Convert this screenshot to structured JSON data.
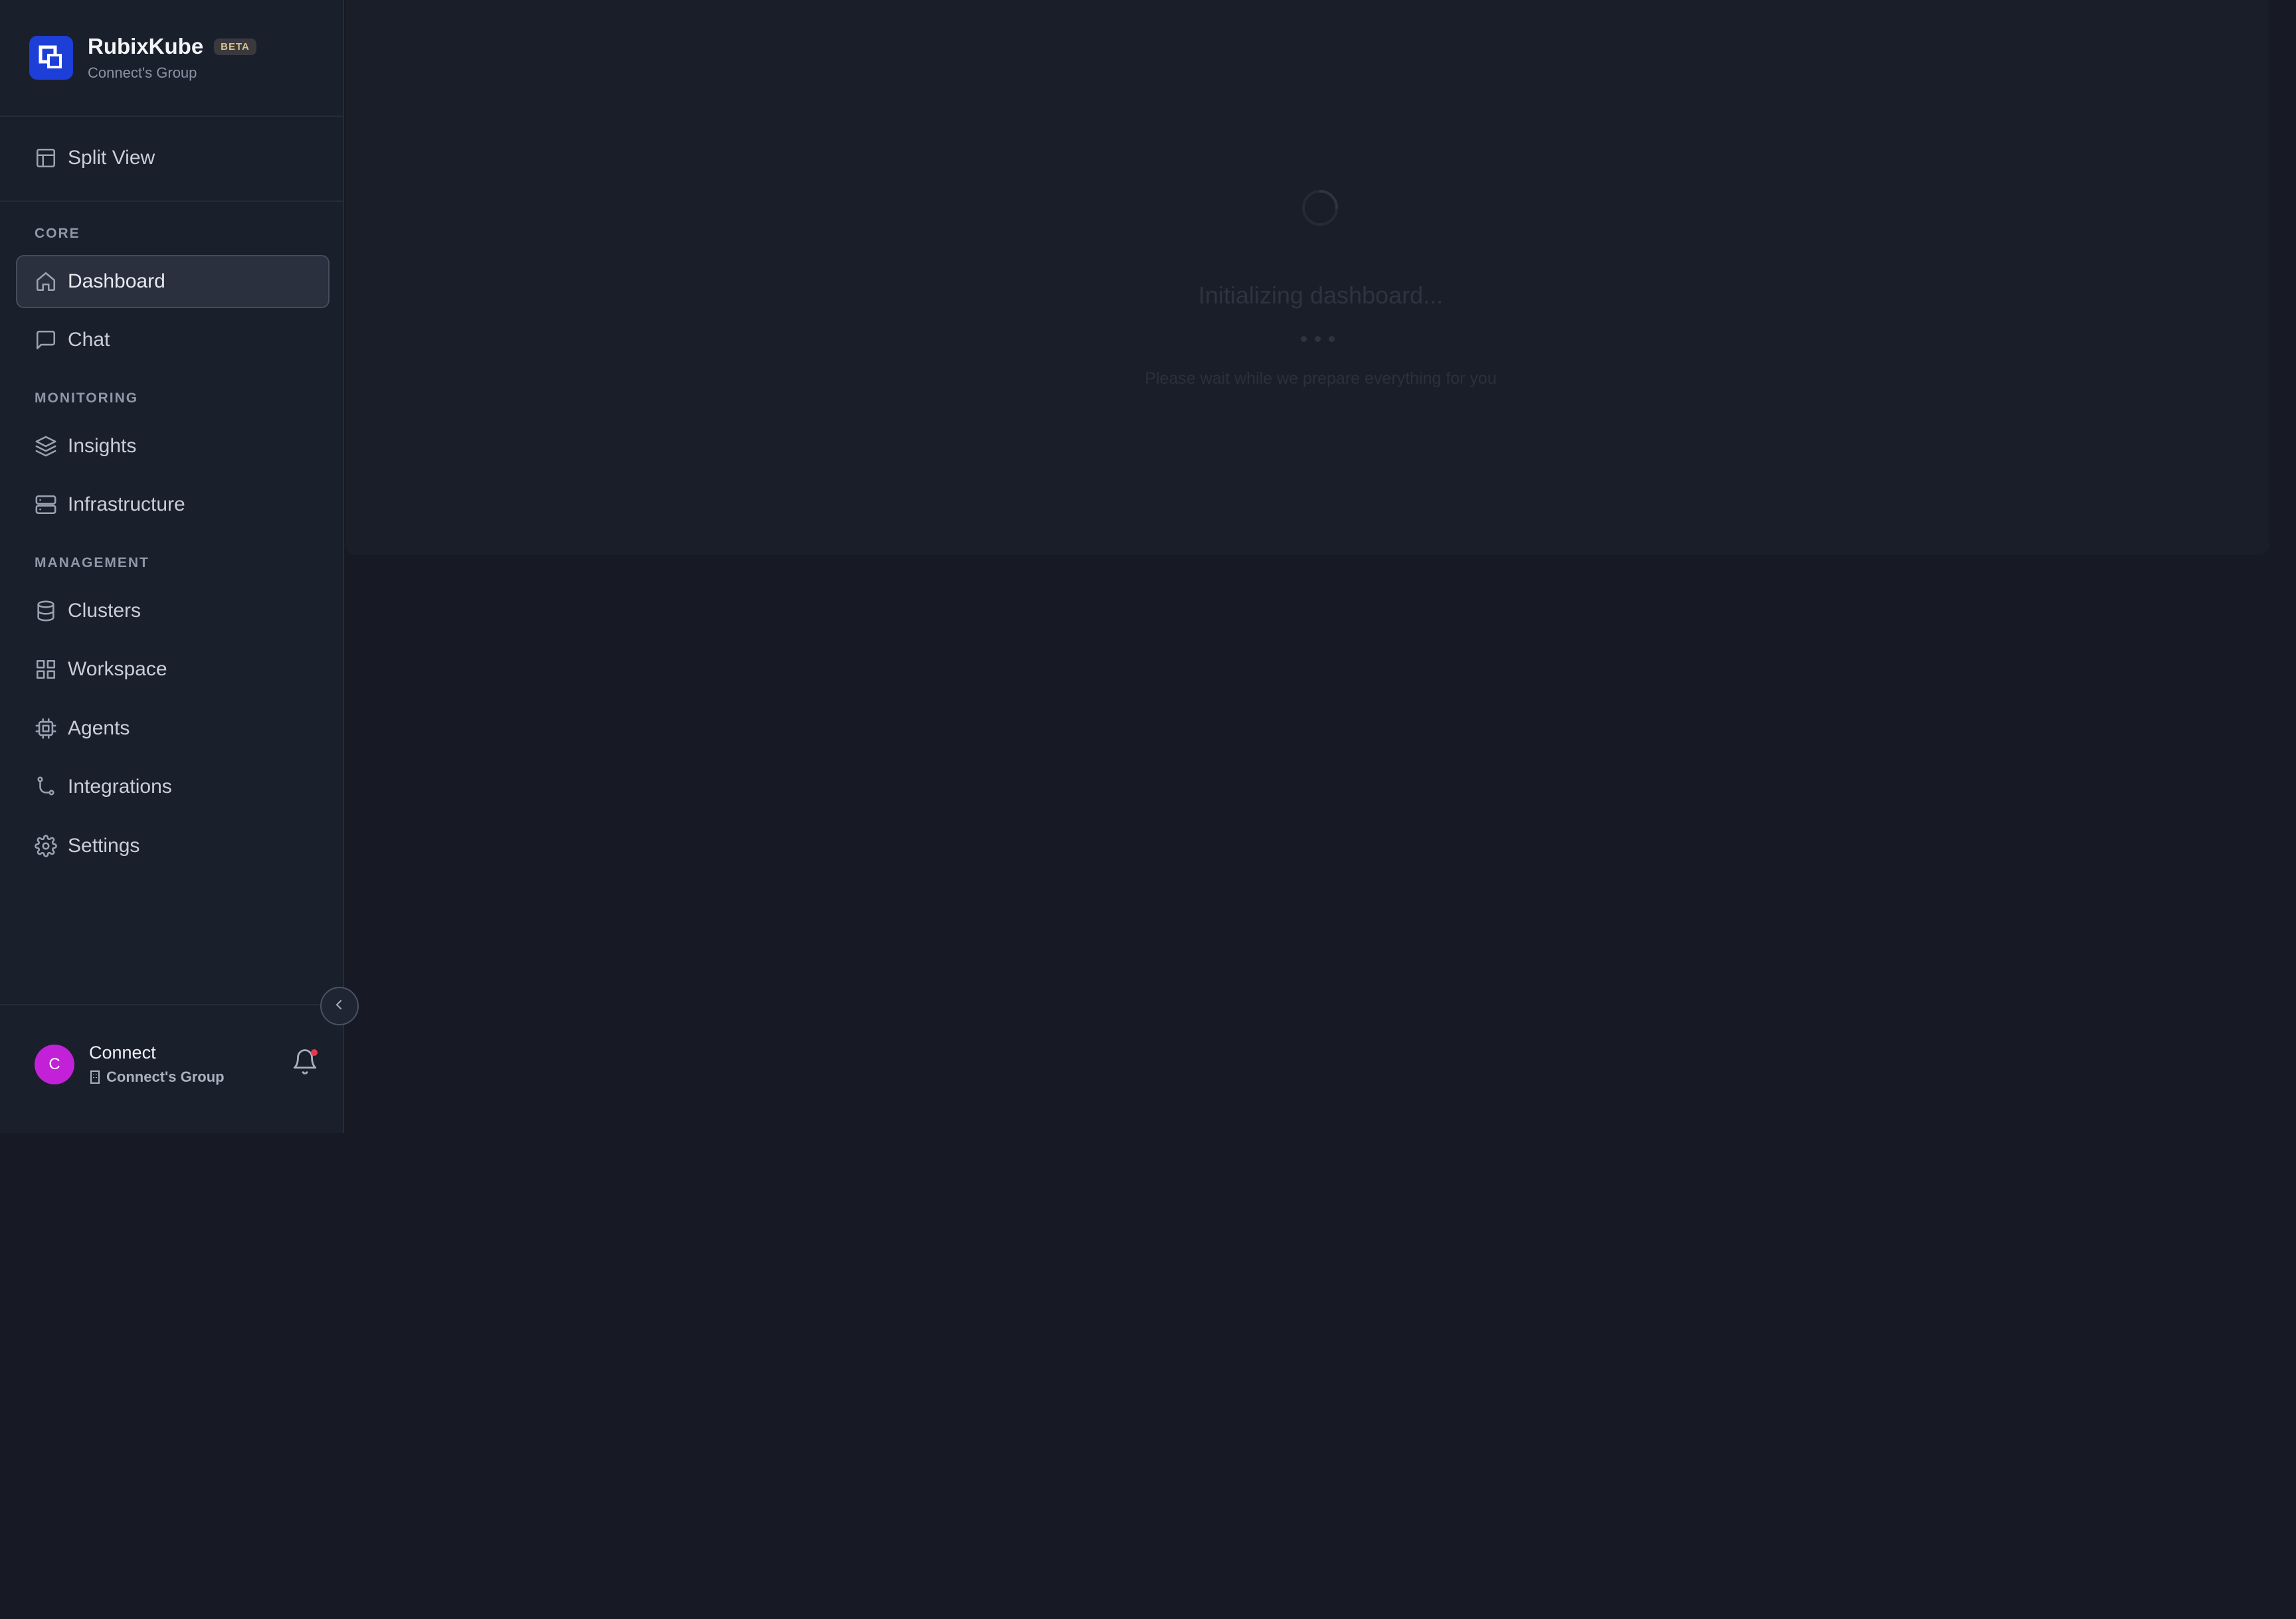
{
  "sidebar": {
    "brand": {
      "name": "RubixKube",
      "badge": "BETA",
      "subtitle": "Connect's Group"
    },
    "split_view": "Split View",
    "sections": [
      {
        "label": "CORE"
      },
      {
        "label": "MONITORING"
      },
      {
        "label": "MANAGEMENT"
      }
    ],
    "items": [
      {
        "label": "Dashboard",
        "icon": "home-icon",
        "active": true
      },
      {
        "label": "Chat",
        "icon": "message-square-icon"
      },
      {
        "label": "Insights",
        "icon": "layers-icon"
      },
      {
        "label": "Infrastructure",
        "icon": "server-icon"
      },
      {
        "label": "Clusters",
        "icon": "database-icon"
      },
      {
        "label": "Workspace",
        "icon": "grid-icon"
      },
      {
        "label": "Agents",
        "icon": "cpu-icon"
      },
      {
        "label": "Integrations",
        "icon": "git-branch-icon"
      },
      {
        "label": "Settings",
        "icon": "gear-icon"
      }
    ],
    "collapse_icon": "chevron-left-icon"
  },
  "user": {
    "avatar_initial": "C",
    "name": "Connect",
    "group": "Connect's Group",
    "notification_icon": "bell-icon",
    "has_notification": true
  },
  "main": {
    "loading_title": "Initializing dashboard...",
    "loading_subtitle": "Please wait while we prepare everything for you"
  },
  "colors": {
    "background": "#171a24",
    "sidebar": "#1a1f2c",
    "brand": "#1d3fd8",
    "avatar": "#c321d8",
    "notification_dot": "#e53950"
  }
}
